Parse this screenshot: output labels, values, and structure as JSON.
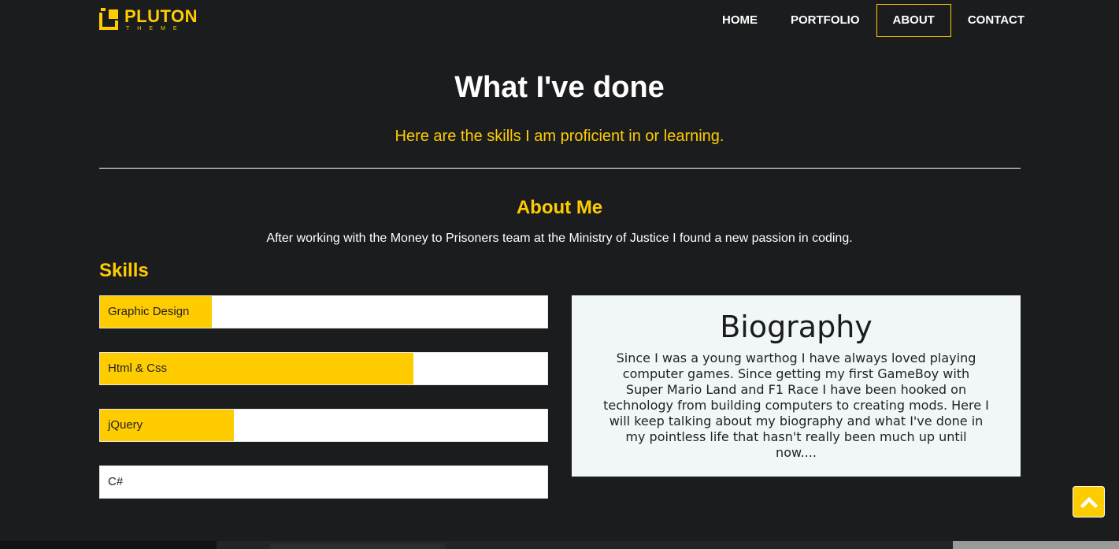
{
  "brand": {
    "name": "PLUTON",
    "tagline": "THEME"
  },
  "nav": {
    "items": [
      {
        "label": "HOME",
        "active": false
      },
      {
        "label": "PORTFOLIO",
        "active": false
      },
      {
        "label": "ABOUT",
        "active": true
      },
      {
        "label": "CONTACT",
        "active": false
      }
    ]
  },
  "section": {
    "title": "What I've done",
    "subtitle": "Here are the skills I am proficient in or learning."
  },
  "about": {
    "heading": "About Me",
    "text": "After working with the Money to Prisoners team at the Ministry of Justice I found a new passion in coding."
  },
  "skills": {
    "heading": "Skills",
    "items": [
      {
        "label": "Graphic Design",
        "level": 0.25
      },
      {
        "label": "Html & Css",
        "level": 0.7
      },
      {
        "label": "jQuery",
        "level": 0.3
      },
      {
        "label": "C#",
        "level": 0.0
      }
    ]
  },
  "biography": {
    "title": "Biography",
    "text": "Since I was a young warthog I have always loved playing computer games. Since getting my first GameBoy with Super Mario Land and F1 Race I have been hooked on technology from building computers to creating mods. Here I will keep talking about my biography and what I've done in my pointless life that hasn't really been much up until now...."
  },
  "scroll_top": {
    "icon": "chevron-up-icon"
  },
  "colors": {
    "accent": "#ffcc00",
    "background": "#1b1c1e",
    "bio_bg": "#f1f6f6"
  }
}
